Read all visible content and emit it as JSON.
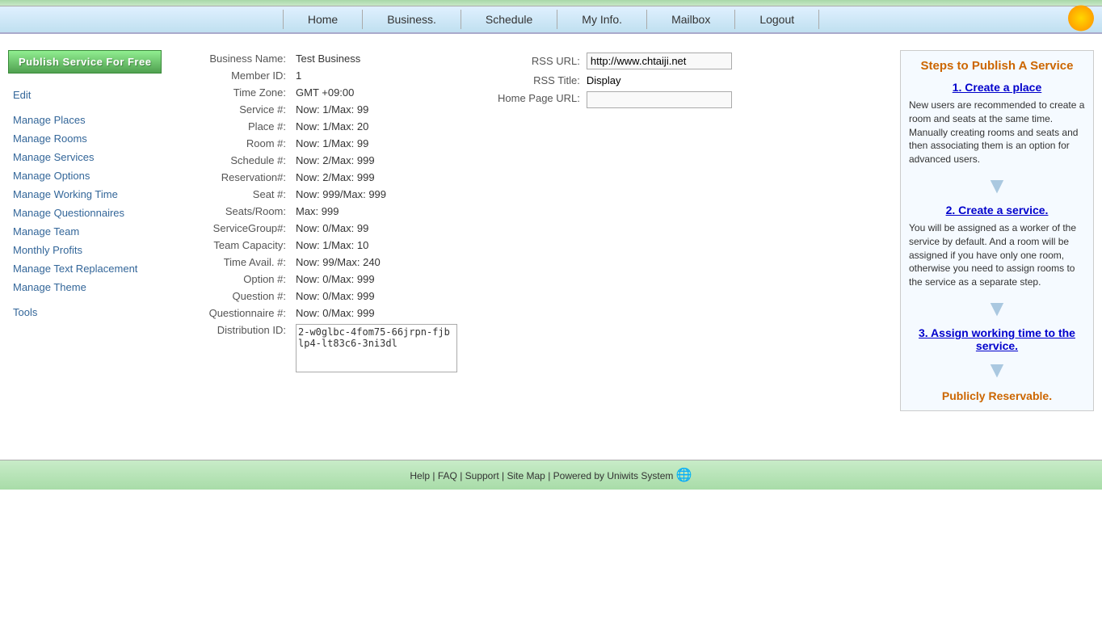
{
  "topbar": {
    "gradient": true
  },
  "nav": {
    "items": [
      {
        "label": "Home",
        "id": "home"
      },
      {
        "label": "Business.",
        "id": "business"
      },
      {
        "label": "Schedule",
        "id": "schedule"
      },
      {
        "label": "My Info.",
        "id": "myinfo"
      },
      {
        "label": "Mailbox",
        "id": "mailbox"
      },
      {
        "label": "Logout",
        "id": "logout"
      }
    ]
  },
  "sidebar": {
    "publish_btn": "Publish Service For Free",
    "edit_label": "Edit",
    "links": [
      {
        "label": "Manage Places",
        "id": "manage-places"
      },
      {
        "label": "Manage Rooms",
        "id": "manage-rooms"
      },
      {
        "label": "Manage Services",
        "id": "manage-services"
      },
      {
        "label": "Manage Options",
        "id": "manage-options"
      },
      {
        "label": "Manage Working Time",
        "id": "manage-working-time"
      },
      {
        "label": "Manage Questionnaires",
        "id": "manage-questionnaires"
      },
      {
        "label": "Manage Team",
        "id": "manage-team"
      },
      {
        "label": "Monthly Profits",
        "id": "monthly-profits"
      },
      {
        "label": "Manage Text Replacement",
        "id": "manage-text-replacement"
      },
      {
        "label": "Manage Theme",
        "id": "manage-theme"
      }
    ],
    "tools_label": "Tools"
  },
  "business_info": {
    "fields": [
      {
        "label": "Business Name:",
        "value": "Test Business"
      },
      {
        "label": "Member ID:",
        "value": "1"
      },
      {
        "label": "Time Zone:",
        "value": "GMT +09:00"
      },
      {
        "label": "Service #:",
        "value": "Now: 1/Max: 99"
      },
      {
        "label": "Place #:",
        "value": "Now: 1/Max: 20"
      },
      {
        "label": "Room #:",
        "value": "Now: 1/Max: 99"
      },
      {
        "label": "Schedule #:",
        "value": "Now: 2/Max: 999"
      },
      {
        "label": "Reservation#:",
        "value": "Now: 2/Max: 999"
      },
      {
        "label": "Seat #:",
        "value": "Now: 999/Max: 999"
      },
      {
        "label": "Seats/Room:",
        "value": "Max: 999"
      },
      {
        "label": "ServiceGroup#:",
        "value": "Now: 0/Max: 99"
      },
      {
        "label": "Team Capacity:",
        "value": "Now: 1/Max: 10"
      },
      {
        "label": "Time Avail. #:",
        "value": "Now: 99/Max: 240"
      },
      {
        "label": "Option #:",
        "value": "Now: 0/Max: 999"
      },
      {
        "label": "Question #:",
        "value": "Now: 0/Max: 999"
      },
      {
        "label": "Questionnaire #:",
        "value": "Now: 0/Max: 999"
      },
      {
        "label": "Distribution ID:",
        "value": "2-w0glbc-4fom75-66jrpn-fjblp4-lt83c6-3ni3dl"
      }
    ]
  },
  "rss": {
    "url_label": "RSS URL:",
    "url_value": "http://www.chtaiji.net",
    "title_label": "RSS Title:",
    "title_value": "Display",
    "home_page_label": "Home Page URL:",
    "home_page_value": ""
  },
  "steps": {
    "title": "Steps to Publish A Service",
    "step1_label": "1. Create a place",
    "step1_desc": "New users are recommended to create a room and seats at the same time. Manually creating rooms and seats and then associating them is an option for advanced users.",
    "step2_label": "2. Create a service.",
    "step2_desc": "You will be assigned as a worker of the service by default. And a room will be assigned if you have only one room, otherwise you need to assign rooms to the service as a separate step.",
    "step3_label": "3. Assign working time to the service.",
    "publicly_label": "Publicly Reservable."
  },
  "footer": {
    "help": "Help",
    "faq": "FAQ",
    "support": "Support",
    "sitemap": "Site Map",
    "powered_by": "| Powered by",
    "company": "Uniwits System"
  }
}
